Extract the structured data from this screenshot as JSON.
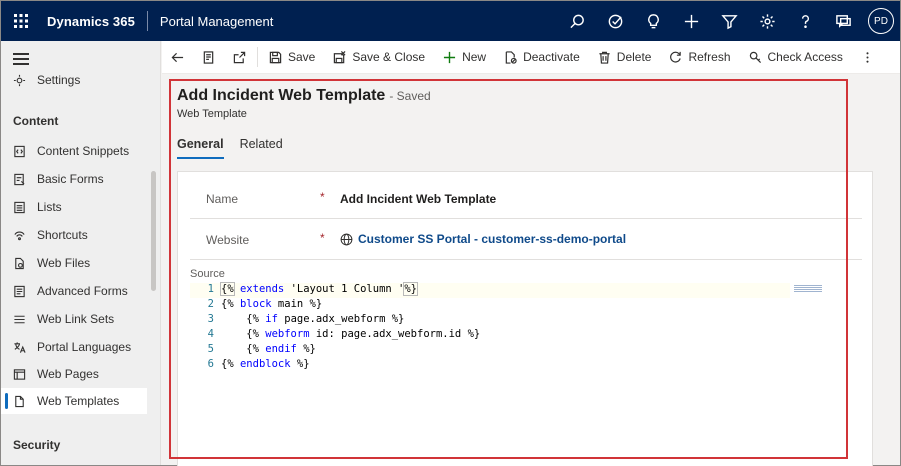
{
  "topbar": {
    "brand": "Dynamics 365",
    "app_name": "Portal Management",
    "avatar_initials": "PD",
    "icons": [
      "search-icon",
      "target-icon",
      "lightbulb-icon",
      "plus-icon",
      "filter-icon",
      "gear-icon",
      "help-icon",
      "chat-icon"
    ]
  },
  "sidebar": {
    "partial_item": "Settings",
    "group_content": "Content",
    "items": [
      {
        "label": "Content Snippets",
        "icon": "snippet-icon"
      },
      {
        "label": "Basic Forms",
        "icon": "form-icon"
      },
      {
        "label": "Lists",
        "icon": "list-icon"
      },
      {
        "label": "Shortcuts",
        "icon": "shortcut-icon"
      },
      {
        "label": "Web Files",
        "icon": "file-icon"
      },
      {
        "label": "Advanced Forms",
        "icon": "advanced-form-icon"
      },
      {
        "label": "Web Link Sets",
        "icon": "linkset-icon"
      },
      {
        "label": "Portal Languages",
        "icon": "language-icon"
      },
      {
        "label": "Web Pages",
        "icon": "webpage-icon"
      },
      {
        "label": "Web Templates",
        "icon": "template-icon"
      }
    ],
    "active_item": "Web Templates",
    "group_security": "Security"
  },
  "commandbar": {
    "save": "Save",
    "save_close": "Save & Close",
    "new": "New",
    "deactivate": "Deactivate",
    "delete": "Delete",
    "refresh": "Refresh",
    "check_access": "Check Access"
  },
  "record": {
    "title": "Add Incident Web Template",
    "status": "- Saved",
    "entity": "Web Template",
    "tabs": [
      "General",
      "Related"
    ],
    "fields": {
      "name_label": "Name",
      "name_value": "Add Incident Web Template",
      "website_label": "Website",
      "website_value": "Customer SS Portal - customer-ss-demo-portal",
      "required_mark": "*"
    },
    "source_label": "Source",
    "source_lines": [
      {
        "n": "1",
        "indent": "",
        "open": "{%",
        "kw": " extends ",
        "rest": "'Layout 1 Column '",
        "close": "%}"
      },
      {
        "n": "2",
        "indent": "",
        "open": "{%",
        "kw": " block ",
        "rest": "main ",
        "close": "%}"
      },
      {
        "n": "3",
        "indent": "    ",
        "open": "{%",
        "kw": " if ",
        "rest": "page.adx_webform ",
        "close": "%}"
      },
      {
        "n": "4",
        "indent": "    ",
        "open": "{%",
        "kw": " webform ",
        "rest": "id: page.adx_webform.id ",
        "close": "%}"
      },
      {
        "n": "5",
        "indent": "    ",
        "open": "{%",
        "kw": " endif ",
        "rest": "",
        "close": "%}"
      },
      {
        "n": "6",
        "indent": "",
        "open": "{%",
        "kw": " endblock ",
        "rest": "",
        "close": "%}"
      }
    ]
  },
  "colors": {
    "topbar": "#002050",
    "accent": "#0f6cbd",
    "highlight": "#d13438",
    "link": "#0f4a8a"
  }
}
